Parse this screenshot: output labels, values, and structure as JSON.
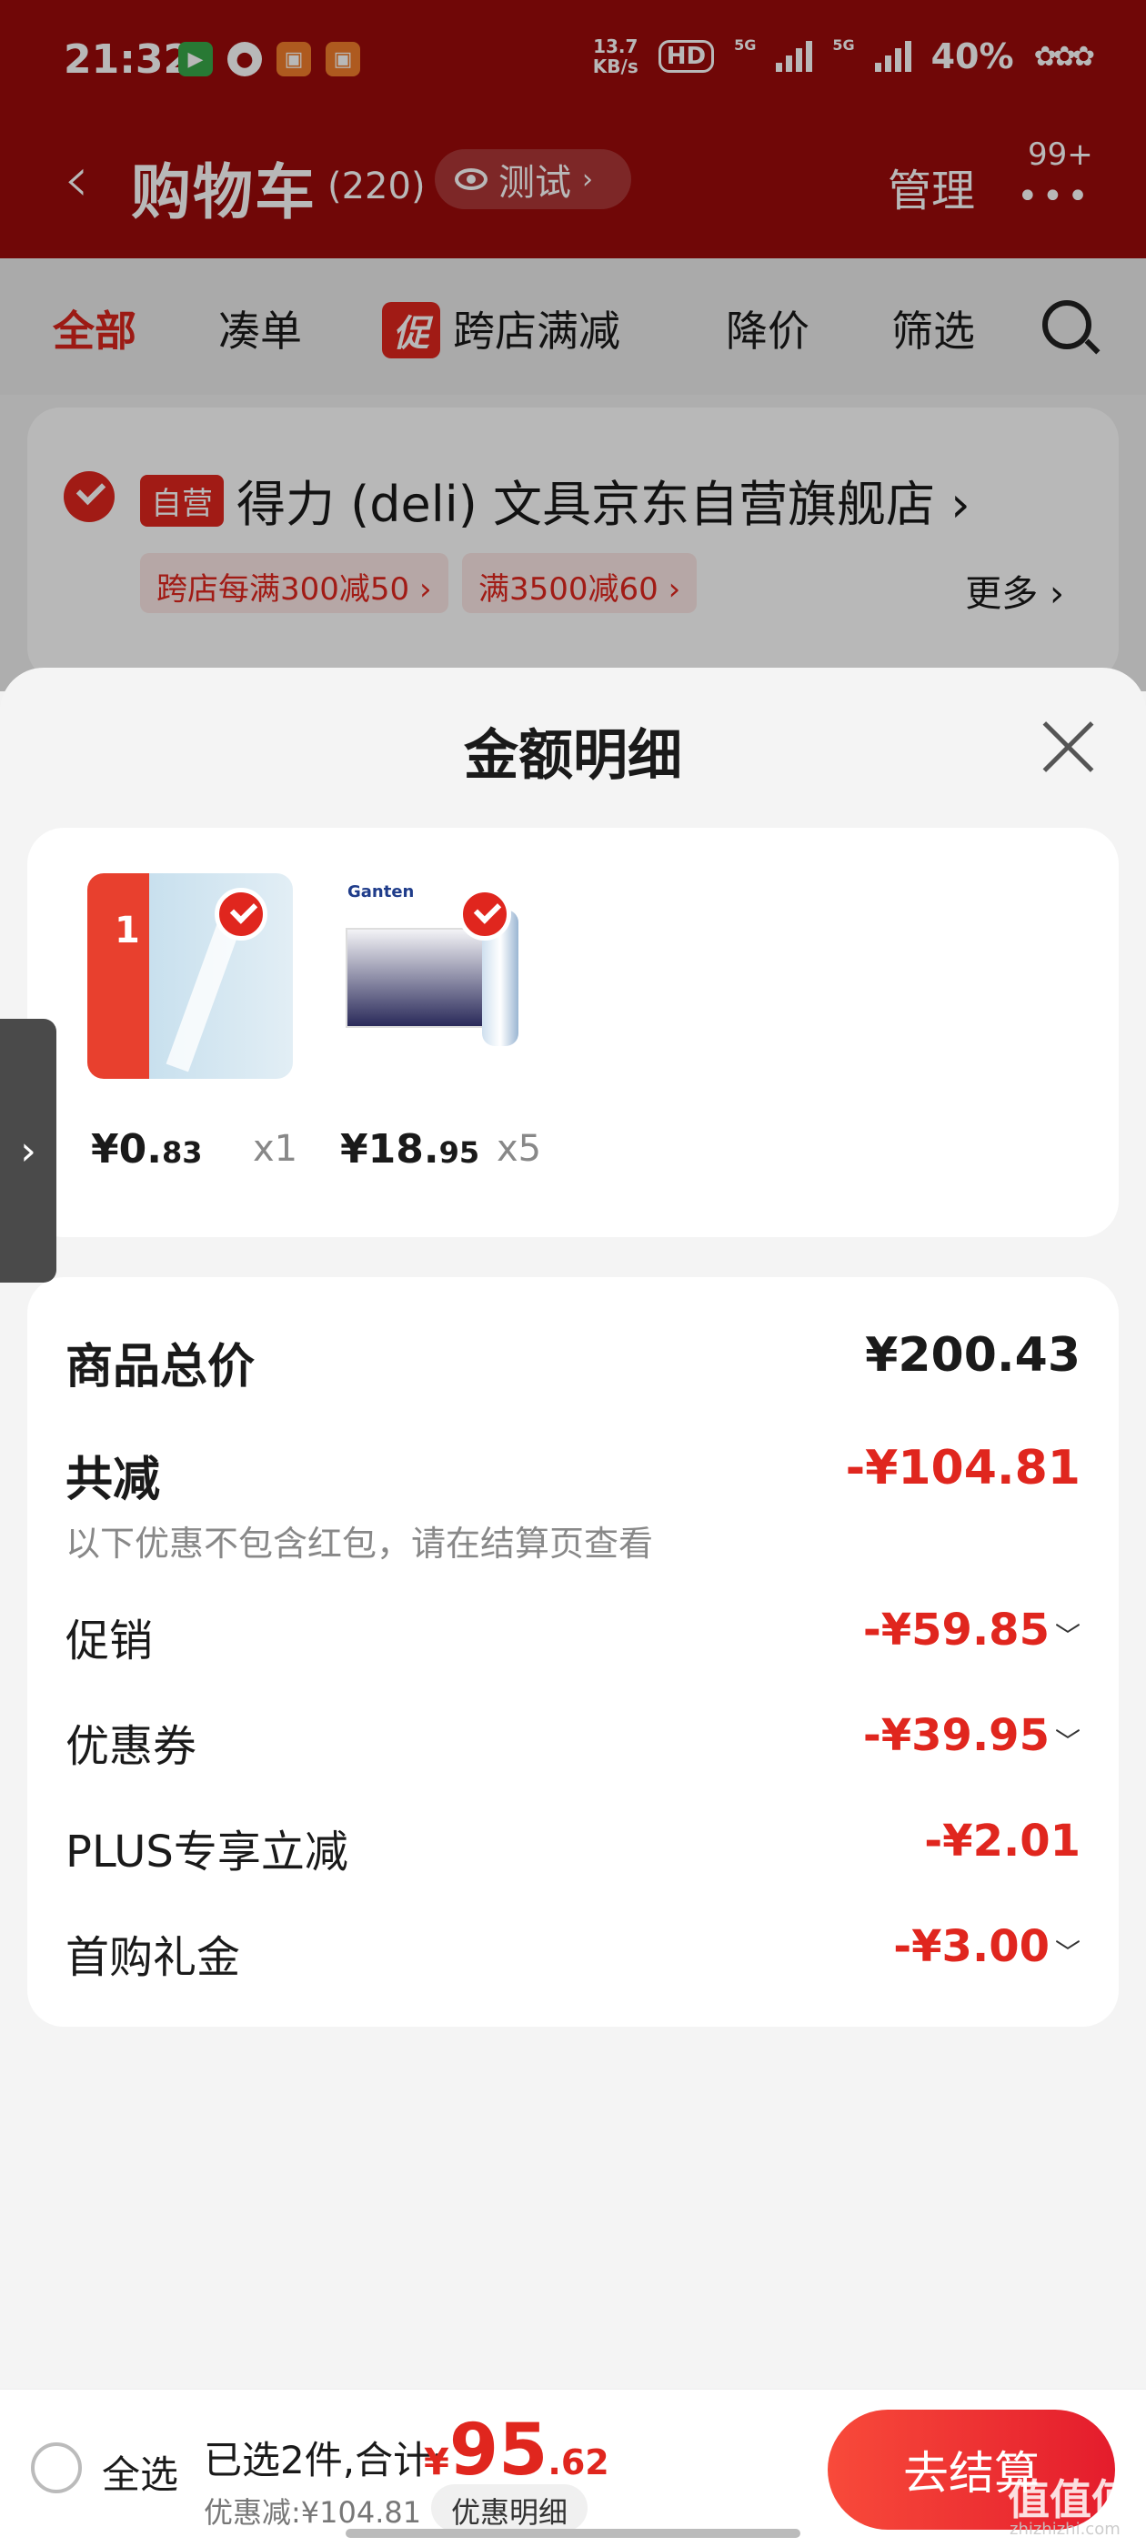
{
  "status_bar": {
    "time": "21:32",
    "net_speed_value": "13.7",
    "net_speed_unit": "KB/s",
    "hd_label": "HD",
    "battery": "40%",
    "signal_1_label": "5G",
    "signal_2_label": "5G"
  },
  "header": {
    "title": "购物车",
    "count": "(220)",
    "test_label": "测试",
    "manage_label": "管理",
    "more_badge": "99+"
  },
  "tabs": {
    "all": "全部",
    "bundle": "凑单",
    "promo_tag": "促",
    "cross_store": "跨店满减",
    "price_drop": "降价",
    "filter": "筛选"
  },
  "store": {
    "tag": "自营",
    "name": "得力 (deli) 文具京东自营旗舰店",
    "coupon_1": "跨店每满300减50",
    "coupon_2": "满3500减60",
    "more": "更多"
  },
  "sheet": {
    "title": "金额明细",
    "products": [
      {
        "price_int": "¥0.",
        "price_dec": "83",
        "qty": "x1",
        "img_num": "1"
      },
      {
        "price_int": "¥18.",
        "price_dec": "95",
        "qty": "x5",
        "img_brand": "Ganten"
      }
    ],
    "rows": {
      "total_label": "商品总价",
      "total_value": "¥200.43",
      "reduce_label": "共减",
      "reduce_value": "-¥104.81",
      "note": "以下优惠不包含红包，请在结算页查看",
      "promo_label": "促销",
      "promo_value": "-¥59.85",
      "coupon_label": "优惠券",
      "coupon_value": "-¥39.95",
      "plus_label": "PLUS专享立减",
      "plus_value": "-¥2.01",
      "gift_label": "首购礼金",
      "gift_value": "-¥3.00"
    }
  },
  "bottom_bar": {
    "select_all": "全选",
    "selected_text": "已选2件,合计:",
    "total_yen": "¥",
    "total_int": "95",
    "total_dec": ".62",
    "discount_text": "优惠减:¥104.81",
    "detail_button": "优惠明细",
    "checkout_button": "去结算",
    "watermark": "值值值",
    "watermark_sub": "zhizhizhi.com"
  }
}
